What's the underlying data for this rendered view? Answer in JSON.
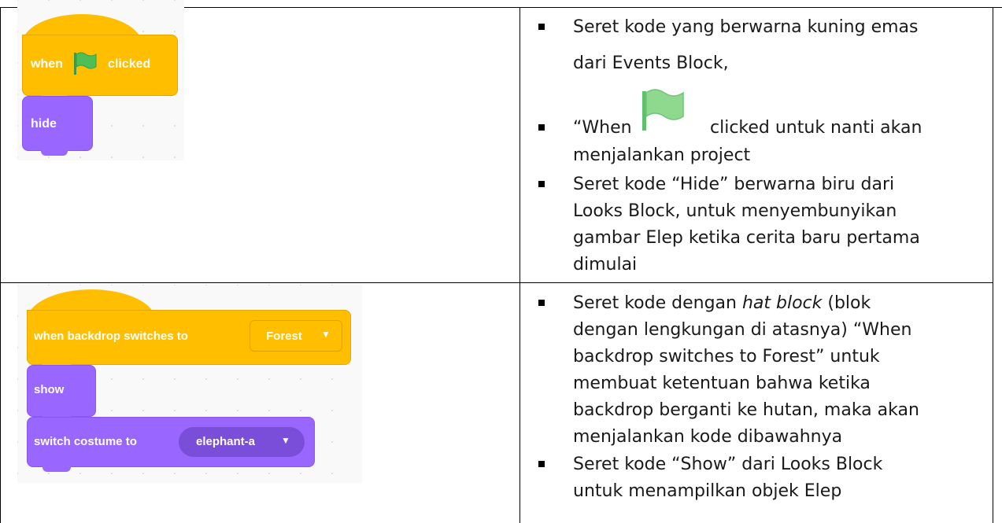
{
  "row1": {
    "script": {
      "hat_when": "when",
      "hat_clicked": "clicked",
      "looks_block": "hide",
      "flag_icon": "green-flag-icon",
      "colors": {
        "events": "#ffbf00",
        "looks": "#9966ff",
        "flag": "#4cbf56"
      }
    },
    "bullets": [
      {
        "lines": [
          "Seret kode yang berwarna kuning emas",
          "dari Events Block,"
        ]
      },
      {
        "line1_before": "“When",
        "line1_after": "clicked untuk nanti akan",
        "line2": "menjalankan project"
      },
      {
        "lines": [
          "Seret kode “Hide” berwarna biru dari",
          "Looks Block, untuk menyembunyikan",
          "gambar Elep ketika cerita baru pertama",
          "dimulai"
        ]
      }
    ]
  },
  "row2": {
    "script": {
      "hat_label": "when backdrop switches to",
      "hat_dropdown": "Forest",
      "show_block": "show",
      "costume_label": "switch costume to",
      "costume_dropdown": "elephant-a",
      "dropdown_icon": "caret-down-icon"
    },
    "bullets": [
      {
        "parts": [
          "Seret kode dengan ",
          "hat block",
          " (blok"
        ],
        "lines": [
          "dengan lengkungan di atasnya) “When",
          "backdrop switches to Forest” untuk",
          "membuat ketentuan bahwa ketika",
          "backdrop berganti ke hutan, maka akan",
          "menjalankan kode dibawahnya"
        ]
      },
      {
        "lines": [
          "Seret kode “Show” dari Looks Block",
          "untuk menampilkan objek Elep"
        ]
      }
    ]
  }
}
